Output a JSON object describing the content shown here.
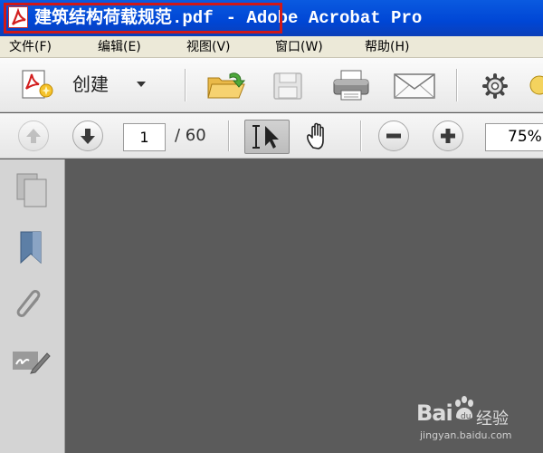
{
  "window": {
    "document_name": "建筑结构荷载规范.pdf",
    "app_title": "- Adobe Acrobat Pro"
  },
  "menu": {
    "items": [
      {
        "label": "文件(F)"
      },
      {
        "label": "编辑(E)"
      },
      {
        "label": "视图(V)"
      },
      {
        "label": "窗口(W)"
      },
      {
        "label": "帮助(H)"
      }
    ]
  },
  "toolbar": {
    "create_label": "创建",
    "icons": [
      "create-pdf-icon",
      "open-folder-icon",
      "save-icon",
      "print-icon",
      "email-icon",
      "gear-icon"
    ]
  },
  "navigation": {
    "current_page": "1",
    "total_pages": "/ 60",
    "zoom": "75%"
  },
  "side_panel": {
    "icons": [
      "pages-icon",
      "bookmark-icon",
      "attachment-icon",
      "signature-icon"
    ]
  },
  "watermark": {
    "brand": "Bai",
    "site": "经验",
    "url": "jingyan.baidu.com"
  },
  "colors": {
    "titlebar": "#0046d5",
    "highlight_border": "#d01818",
    "document_background": "#5b5b5b"
  }
}
